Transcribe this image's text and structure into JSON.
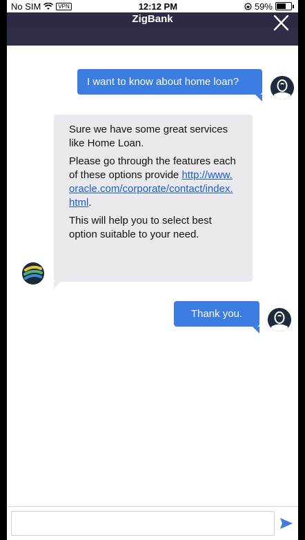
{
  "status_bar": {
    "carrier": "No SIM",
    "vpn": "VPN",
    "time": "12:12 PM",
    "battery_percent": "59%",
    "battery_level": 0.59
  },
  "header": {
    "title": "ZigBank",
    "close_icon": "close-icon",
    "background_color": "#2b2b45"
  },
  "messages": [
    {
      "sender": "user",
      "text": "I want to know about home loan?"
    },
    {
      "sender": "bot",
      "paragraph_1": "Sure we have some great services like Home Loan.",
      "paragraph_2_prefix": "Please go through the features each of these options provide",
      "link": "http://www.oracle.com/corporate/contact/index.html",
      "paragraph_2_suffix": ".",
      "paragraph_3": "This will help you to select best option suitable to your need."
    },
    {
      "sender": "user",
      "text": "Thank you."
    }
  ],
  "composer": {
    "placeholder": "",
    "send_icon": "send-icon",
    "accent_color": "#3b7de0"
  }
}
